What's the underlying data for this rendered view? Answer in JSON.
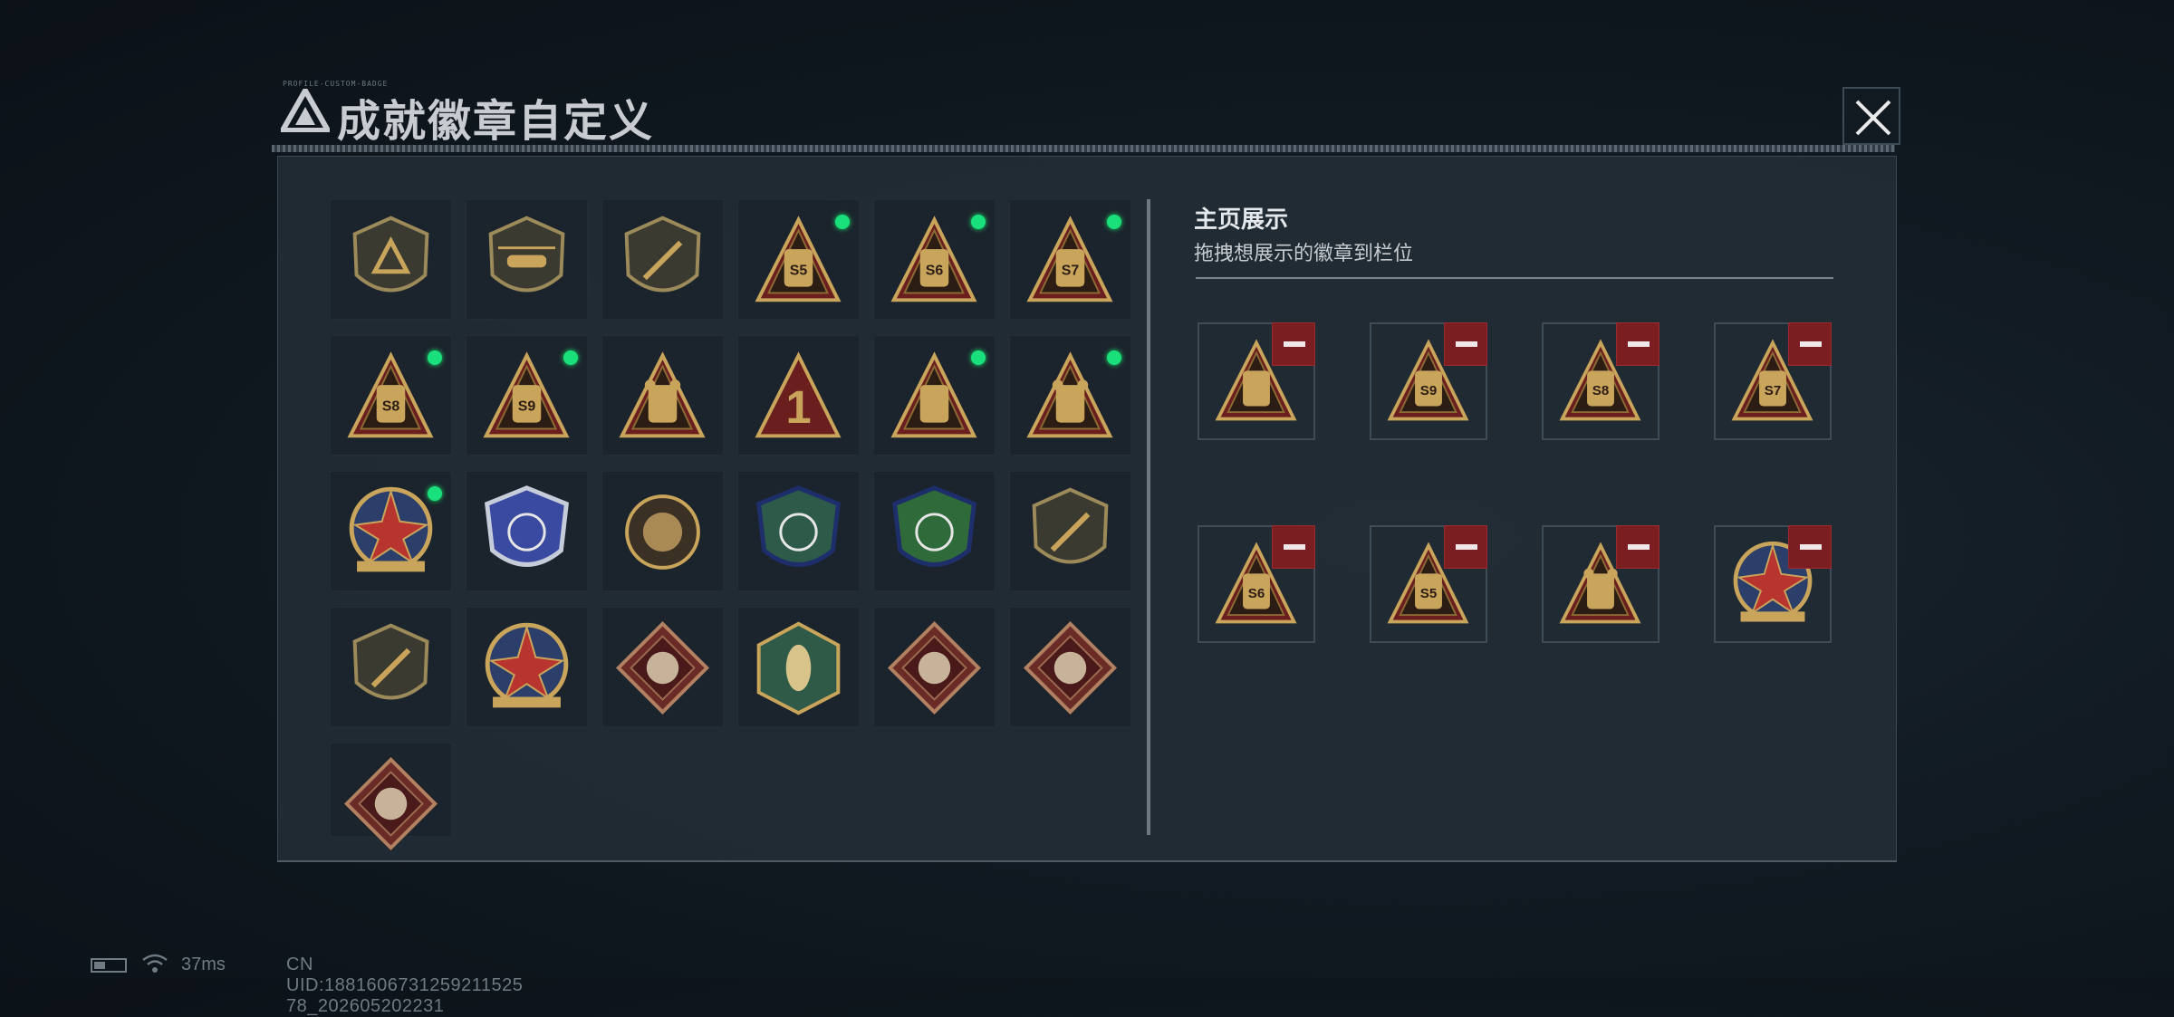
{
  "window": {
    "title": "成就徽章自定义",
    "title_small": "PROFILE-CUSTOM-BADGE",
    "close_icon": "close-icon"
  },
  "colors": {
    "accent_green": "#19e07a",
    "remove_red": "#7a1e22",
    "gold": "#c9a55c",
    "panel_bg": "#222c35"
  },
  "badge_grid": {
    "badges": [
      {
        "icon": "delta-shield-badge-icon",
        "new": false
      },
      {
        "icon": "helicopter-shield-badge-icon",
        "new": false
      },
      {
        "icon": "dagger-shield-badge-icon",
        "new": false
      },
      {
        "icon": "s5-backpack-triangle-badge-icon",
        "new": true,
        "text": "S5"
      },
      {
        "icon": "s6-goggles-triangle-badge-icon",
        "new": true,
        "text": "S6"
      },
      {
        "icon": "s7-canister-triangle-badge-icon",
        "new": true,
        "text": "S7"
      },
      {
        "icon": "s8-backpack-triangle-badge-icon",
        "new": true,
        "text": "S8"
      },
      {
        "icon": "s9-drone-triangle-badge-icon",
        "new": true,
        "text": "S9"
      },
      {
        "icon": "rock-hand-triangle-badge-icon",
        "new": false
      },
      {
        "icon": "number-one-triangle-badge-icon",
        "new": false,
        "text": "1"
      },
      {
        "icon": "usb-drive-triangle-badge-icon",
        "new": true
      },
      {
        "icon": "soldiers-triangle-badge-icon",
        "new": true
      },
      {
        "icon": "compass-star-badge-icon",
        "new": true
      },
      {
        "icon": "blue-wings-crest-badge-icon",
        "new": false
      },
      {
        "icon": "skull-round-badge-icon",
        "new": false
      },
      {
        "icon": "blue-rifle-shield-badge-icon",
        "new": false
      },
      {
        "icon": "green-rifle-shield-badge-icon",
        "new": false
      },
      {
        "icon": "knife-shield-badge-icon",
        "new": false
      },
      {
        "icon": "knife-round-shield-badge-icon",
        "new": false
      },
      {
        "icon": "gold-blue-star-shield-badge-icon",
        "new": false
      },
      {
        "icon": "wolf-diamond-badge-icon",
        "new": false
      },
      {
        "icon": "wasp-hexagon-badge-icon",
        "new": false
      },
      {
        "icon": "dragon-diamond-badge-icon",
        "new": false
      },
      {
        "icon": "dragon-diamond-badge-icon-2",
        "new": false
      },
      {
        "icon": "runner-diamond-badge-icon",
        "new": false
      }
    ]
  },
  "showcase": {
    "title": "主页展示",
    "subtitle": "拖拽想展示的徽章到栏位",
    "slots": [
      {
        "icon": "usb-drive-triangle-badge-icon"
      },
      {
        "icon": "s9-drone-triangle-badge-icon",
        "text": "S9"
      },
      {
        "icon": "s8-backpack-triangle-badge-icon",
        "text": "S8"
      },
      {
        "icon": "s7-canister-triangle-badge-icon",
        "text": "S7"
      },
      {
        "icon": "s6-goggles-triangle-badge-icon",
        "text": "S6"
      },
      {
        "icon": "s5-backpack-triangle-badge-icon",
        "text": "S5"
      },
      {
        "icon": "soldiers-triangle-badge-icon"
      },
      {
        "icon": "compass-star-badge-icon"
      }
    ],
    "remove_icon": "minus-icon"
  },
  "status_bar": {
    "battery_icon": "battery-icon",
    "wifi_icon": "wifi-icon",
    "ping": "37ms",
    "uid": "CN UID:1881606731259211525​78_202605202231"
  }
}
